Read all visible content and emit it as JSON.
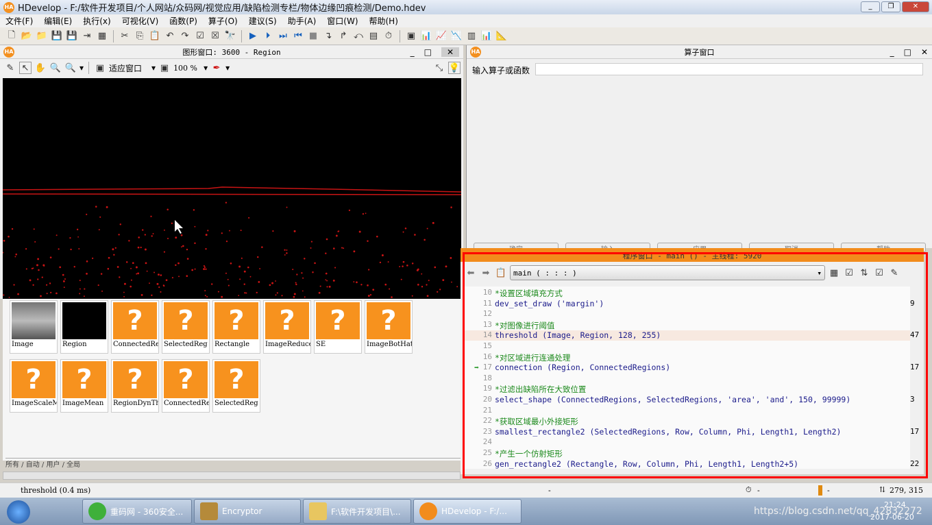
{
  "window": {
    "title": "HDevelop - F:/软件开发项目/个人网站/众码网/视觉应用/缺陷检测专栏/物体边缘凹痕检测/Demo.hdev",
    "app_badge": "HA"
  },
  "menu": [
    "文件(F)",
    "编辑(E)",
    "执行(x)",
    "可视化(V)",
    "函数(P)",
    "算子(O)",
    "建议(S)",
    "助手(A)",
    "窗口(W)",
    "帮助(H)"
  ],
  "graphics": {
    "title": "图形窗口: 3600 - Region",
    "fit_label": "适应窗口",
    "zoom": "100 %",
    "accent": "#c81414"
  },
  "variables": {
    "items": [
      "Image",
      "Region",
      "ConnectedRe",
      "SelectedReg",
      "Rectangle",
      "ImageReduce",
      "SE",
      "ImageBotHat",
      "ImageScaleM",
      "ImageMean",
      "RegionDynTh",
      "ConnectedRe",
      "SelectedReg"
    ],
    "tabs": "所有 / 自动 / 用户 / 全局"
  },
  "operator": {
    "title": "算子窗口",
    "input_label": "输入算子或函数",
    "buttons": [
      "确定",
      "输入",
      "应用",
      "取消",
      "帮助"
    ]
  },
  "program": {
    "title": "程序窗口 - main () - 主线程: 5920",
    "procedure": "main ( : : : )",
    "lines": [
      {
        "n": "10",
        "text": "*设置区域填充方式",
        "kind": "cm",
        "right": ""
      },
      {
        "n": "11",
        "text": "dev_set_draw ('margin')",
        "kind": "cd",
        "right": "9"
      },
      {
        "n": "12",
        "text": "",
        "kind": "cd",
        "right": ""
      },
      {
        "n": "13",
        "text": "*对图像进行阈值",
        "kind": "cm",
        "right": ""
      },
      {
        "n": "14",
        "text": "threshold (Image, Region, 128, 255)",
        "kind": "cd",
        "right": "47"
      },
      {
        "n": "15",
        "text": "",
        "kind": "cd",
        "right": ""
      },
      {
        "n": "16",
        "text": "*对区域进行连通处理",
        "kind": "cm",
        "right": ""
      },
      {
        "n": "17",
        "text": "connection (Region, ConnectedRegions)",
        "kind": "cd",
        "right": "17"
      },
      {
        "n": "18",
        "text": "",
        "kind": "cd",
        "right": ""
      },
      {
        "n": "19",
        "text": "*过滤出缺陷所在大致位置",
        "kind": "cm",
        "right": ""
      },
      {
        "n": "20",
        "text": "select_shape (ConnectedRegions, SelectedRegions, 'area', 'and', 150, 99999)",
        "kind": "cd",
        "right": "3"
      },
      {
        "n": "21",
        "text": "",
        "kind": "cd",
        "right": ""
      },
      {
        "n": "22",
        "text": "*获取区域最小外接矩形",
        "kind": "cm",
        "right": ""
      },
      {
        "n": "23",
        "text": "smallest_rectangle2 (SelectedRegions, Row, Column, Phi, Length1, Length2)",
        "kind": "cd",
        "right": "17"
      },
      {
        "n": "24",
        "text": "",
        "kind": "cd",
        "right": ""
      },
      {
        "n": "25",
        "text": "*产生一个仿射矩形",
        "kind": "cm",
        "right": ""
      },
      {
        "n": "26",
        "text": "gen_rectangle2 (Rectangle, Row, Column, Phi, Length1, Length2+5)",
        "kind": "cd",
        "right": "22"
      }
    ]
  },
  "status": {
    "message": "threshold (0.4 ms)",
    "a": "-",
    "b": "-",
    "c": "-",
    "coords": "279, 315"
  },
  "taskbar": {
    "items": [
      "重码网 - 360安全...",
      "Encryptor",
      "F:\\软件开发项目\\...",
      "HDevelop - F:/..."
    ],
    "time": "21:24",
    "date": "2017-06-20",
    "watermark": "https://blog.csdn.net/qq_42832272"
  }
}
